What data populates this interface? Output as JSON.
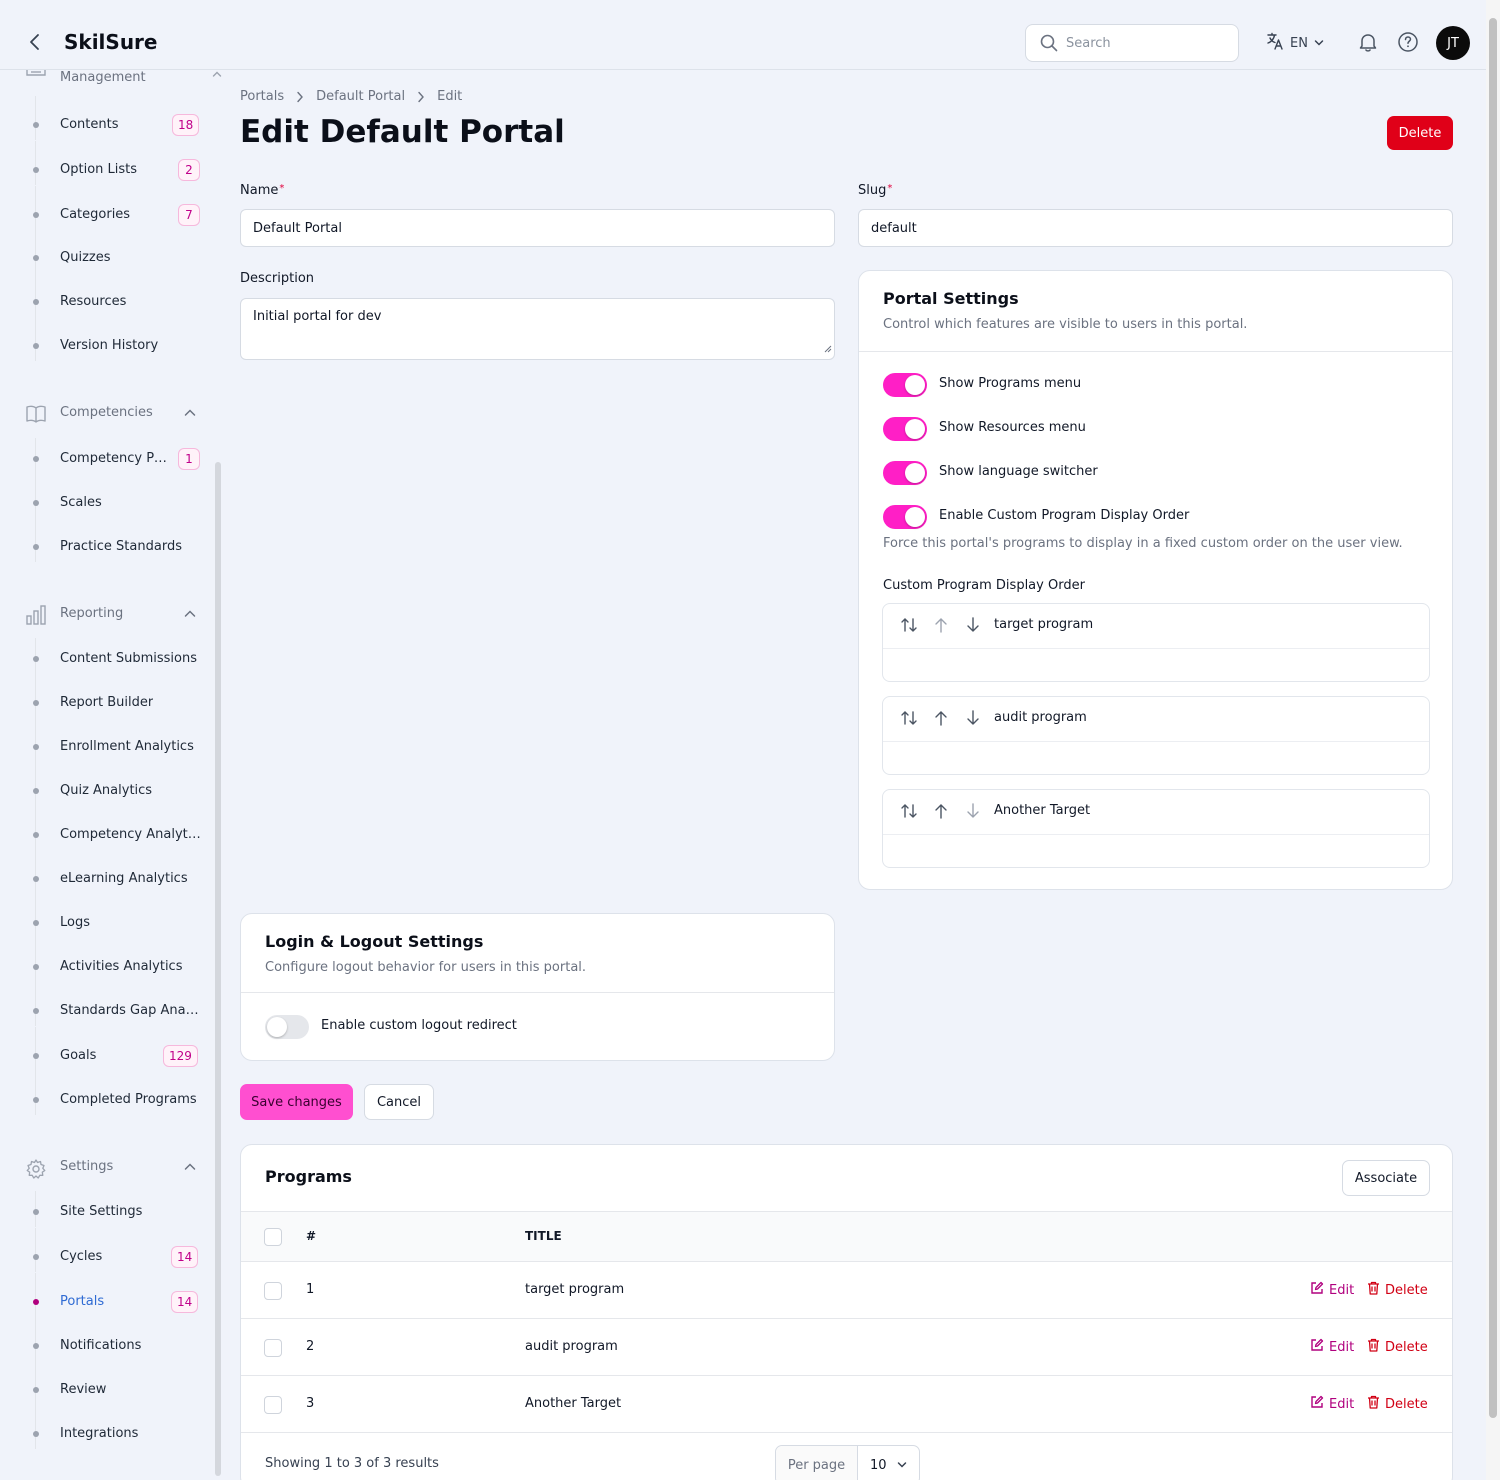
{
  "app": {
    "brand": "SkilSure"
  },
  "header": {
    "search_placeholder": "Search",
    "language": "EN",
    "avatar_initials": "JT"
  },
  "sidebar": {
    "groups": [
      {
        "label": "Management",
        "items": [
          {
            "label": "Contents",
            "badge": "18"
          },
          {
            "label": "Option Lists",
            "badge": "2"
          },
          {
            "label": "Categories",
            "badge": "7"
          },
          {
            "label": "Quizzes"
          },
          {
            "label": "Resources"
          },
          {
            "label": "Version History"
          }
        ]
      },
      {
        "label": "Competencies",
        "items": [
          {
            "label": "Competency Profiles",
            "badge": "1"
          },
          {
            "label": "Scales"
          },
          {
            "label": "Practice Standards"
          }
        ]
      },
      {
        "label": "Reporting",
        "items": [
          {
            "label": "Content Submissions"
          },
          {
            "label": "Report Builder"
          },
          {
            "label": "Enrollment Analytics"
          },
          {
            "label": "Quiz Analytics"
          },
          {
            "label": "Competency Analytics"
          },
          {
            "label": "eLearning Analytics"
          },
          {
            "label": "Logs"
          },
          {
            "label": "Activities Analytics"
          },
          {
            "label": "Standards Gap Analysis"
          },
          {
            "label": "Goals",
            "badge": "129"
          },
          {
            "label": "Completed Programs"
          }
        ]
      },
      {
        "label": "Settings",
        "items": [
          {
            "label": "Site Settings"
          },
          {
            "label": "Cycles",
            "badge": "14"
          },
          {
            "label": "Portals",
            "badge": "14",
            "active": true
          },
          {
            "label": "Notifications"
          },
          {
            "label": "Review"
          },
          {
            "label": "Integrations"
          }
        ]
      }
    ]
  },
  "breadcrumb": [
    "Portals",
    "Default Portal",
    "Edit"
  ],
  "page": {
    "title": "Edit Default Portal",
    "delete_label": "Delete"
  },
  "form": {
    "name_label": "Name",
    "name_value": "Default Portal",
    "slug_label": "Slug",
    "slug_value": "default",
    "description_label": "Description",
    "description_value": "Initial portal for dev",
    "required_mark": "*"
  },
  "portal_settings": {
    "title": "Portal Settings",
    "subtitle": "Control which features are visible to users in this portal.",
    "toggles": [
      {
        "label": "Show Programs menu",
        "on": true
      },
      {
        "label": "Show Resources menu",
        "on": true
      },
      {
        "label": "Show language switcher",
        "on": true
      },
      {
        "label": "Enable Custom Program Display Order",
        "on": true
      }
    ],
    "order_help": "Force this portal's programs to display in a fixed custom order on the user view.",
    "order_label": "Custom Program Display Order",
    "order_items": [
      "target program",
      "audit program",
      "Another Target"
    ]
  },
  "login_settings": {
    "title": "Login & Logout Settings",
    "subtitle": "Configure logout behavior for users in this portal.",
    "toggle_label": "Enable custom logout redirect",
    "toggle_on": false
  },
  "actions": {
    "save_label": "Save changes",
    "cancel_label": "Cancel"
  },
  "programs": {
    "title": "Programs",
    "associate_label": "Associate",
    "columns": [
      "#",
      "TITLE"
    ],
    "rows": [
      {
        "num": "1",
        "title": "target program"
      },
      {
        "num": "2",
        "title": "audit program"
      },
      {
        "num": "3",
        "title": "Another Target"
      }
    ],
    "edit_label": "Edit",
    "delete_label": "Delete",
    "showing": "Showing 1 to 3 of 3 results",
    "per_page_label": "Per page",
    "per_page_value": "10"
  },
  "colors": {
    "accent": "#ff1fc6",
    "danger": "#e00018",
    "link": "#2f6bd3"
  }
}
